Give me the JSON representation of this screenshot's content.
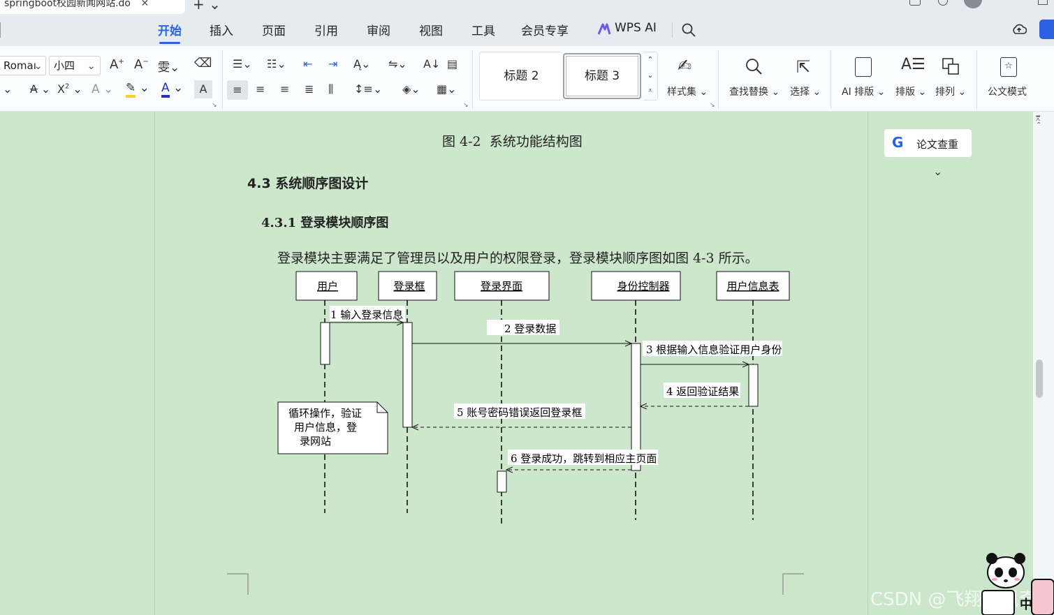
{
  "titlebar": {
    "doc_tab": "springboot校园新闻网站.do"
  },
  "menu": {
    "items": [
      "开始",
      "插入",
      "页面",
      "引用",
      "审阅",
      "视图",
      "工具",
      "会员专享",
      "WPS AI"
    ],
    "active": "开始"
  },
  "toolbar": {
    "font_name": "Romaı",
    "font_size": "小四",
    "style_heading2": "标题 2",
    "style_heading3": "标题 3",
    "style_set": "样式集",
    "find_replace": "查找替换",
    "select": "选择",
    "ai_layout": "AI 排版",
    "layout": "排版",
    "arrange": "排列",
    "official_mode": "公文模式"
  },
  "colors": {
    "accent": "#2b62e3",
    "page_bg": "#cde7cc",
    "highlight_yellow": "#f5d42a",
    "font_color_blue": "#2230c8"
  },
  "document": {
    "figure_caption": "图 4-2  系统功能结构图",
    "section_heading": "4.3 系统顺序图设计",
    "subsection_heading": "4.3.1 登录模块顺序图",
    "paragraph": "登录模块主要满足了管理员以及用户的权限登录，登录模块顺序图如图 4-3 所示。"
  },
  "diagram": {
    "lifelines": [
      "用户",
      "登录框",
      "登录界面",
      "身份控制器",
      "用户信息表"
    ],
    "messages": [
      "1 输入登录信息",
      "2 登录数据",
      "3 根据输入信息验证用户身份",
      "4 返回验证结果",
      "5 账号密码错误返回登录框",
      "6 登录成功，跳转到相应主页面"
    ],
    "note_lines": [
      "循环操作，验证",
      "用户信息，登",
      "录网站"
    ]
  },
  "right_panel": {
    "check_button": "论文查重"
  },
  "watermark": "CSDN @飞翔的佩奇"
}
